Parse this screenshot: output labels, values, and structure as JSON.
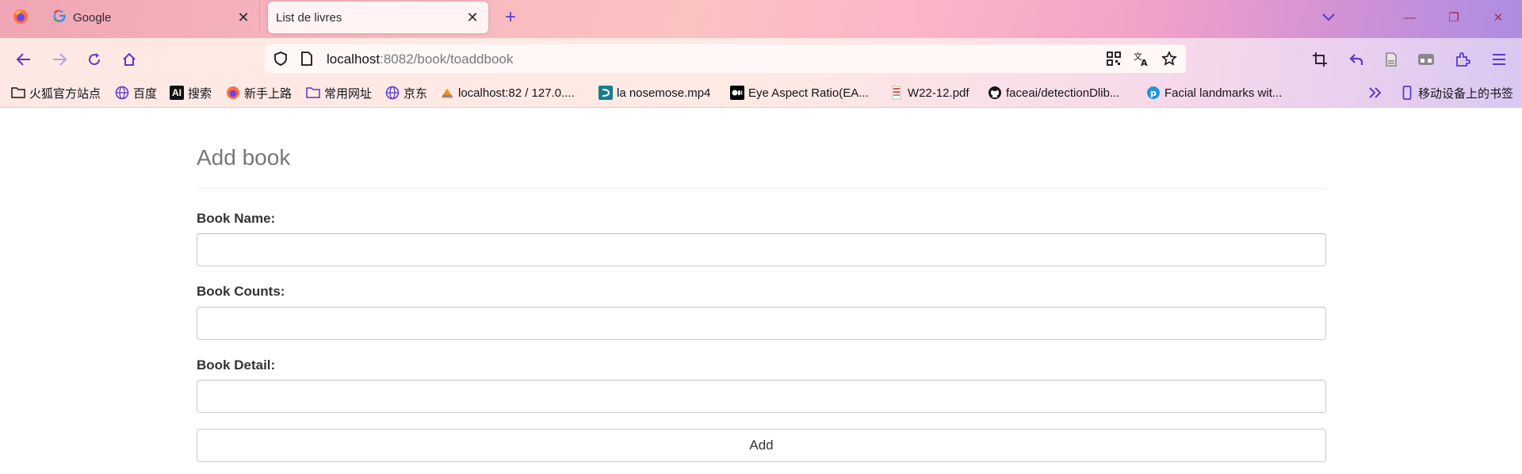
{
  "browser": {
    "tabs": [
      {
        "title": "Google",
        "favicon": "google-icon",
        "active": false
      },
      {
        "title": "List de livres",
        "favicon": "",
        "active": true
      }
    ],
    "url": {
      "host": "localhost",
      "rest": ":8082/book/toaddbook"
    },
    "bookmarks": [
      {
        "label": "火狐官方站点",
        "icon": "folder-icon"
      },
      {
        "label": "百度",
        "icon": "globe-icon"
      },
      {
        "label": "搜索",
        "icon": "ai-icon"
      },
      {
        "label": "新手上路",
        "icon": "firefox-icon"
      },
      {
        "label": "常用网址",
        "icon": "folder-icon"
      },
      {
        "label": "京东",
        "icon": "globe-icon"
      },
      {
        "label": "localhost:82 / 127.0....",
        "icon": "phpmyadmin-icon"
      },
      {
        "label": "la nosemose.mp4",
        "icon": "video-icon"
      },
      {
        "label": "Eye Aspect Ratio(EA...",
        "icon": "medium-icon"
      },
      {
        "label": "W22-12.pdf",
        "icon": "pdf-icon"
      },
      {
        "label": "faceai/detectionDlib...",
        "icon": "github-icon"
      },
      {
        "label": "Facial landmarks wit...",
        "icon": "pyimagesearch-icon"
      }
    ],
    "mobile_bookmarks": "移动设备上的书签",
    "accent_color": "#5b39c8"
  },
  "page": {
    "title": "Add book",
    "fields": [
      {
        "label": "Book Name:",
        "value": ""
      },
      {
        "label": "Book Counts:",
        "value": ""
      },
      {
        "label": "Book Detail:",
        "value": ""
      }
    ],
    "submit_label": "Add"
  }
}
